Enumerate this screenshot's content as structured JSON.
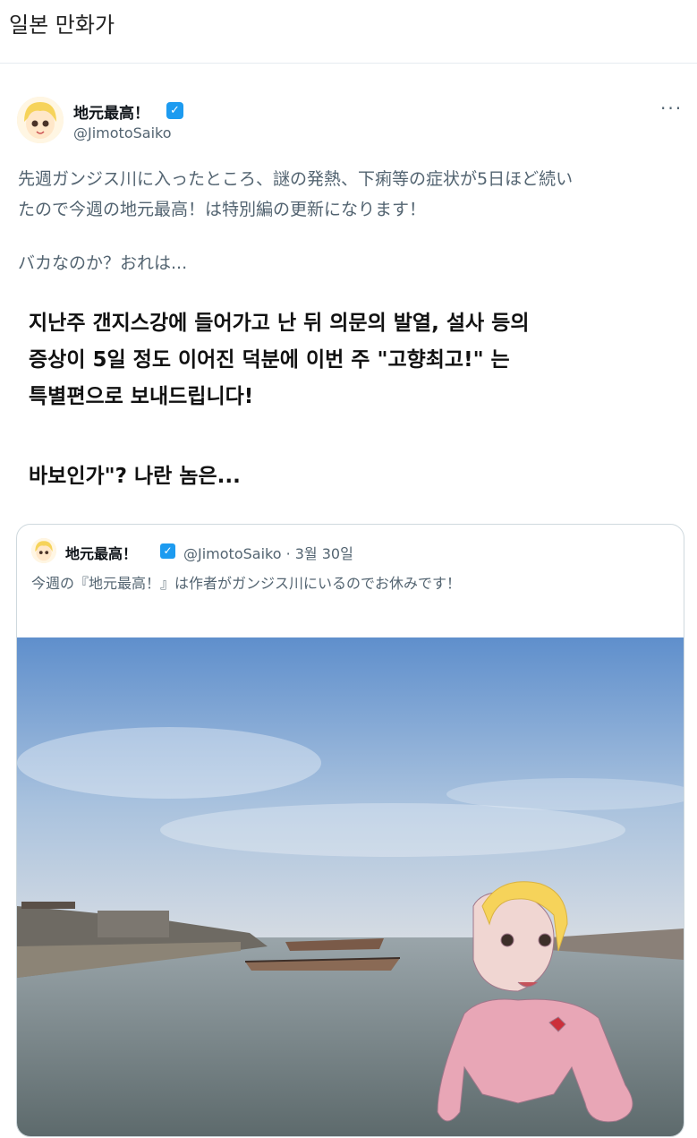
{
  "post": {
    "title": "일본 만화가"
  },
  "tweet": {
    "author_name": "地元最高！",
    "handle": "@JimotoSaiko",
    "verified_icon": "✓",
    "more_icon": "···",
    "text_jp_line1": "先週ガンジス川に入ったところ、謎の発熱、下痢等の症状が5日ほど続い",
    "text_jp_line2": "たので今週の地元最高！は特別編の更新になります！",
    "text_jp_question": "バカなのか？おれは...",
    "text_kr_line1": "지난주 갠지스강에 들어가고 난 뒤 의문의 발열, 설사 등의",
    "text_kr_line2": "증상이 5일 정도 이어진 덕분에 이번 주 \"고향최고!\" 는",
    "text_kr_line3": "특별편으로 보내드립니다!",
    "text_kr_question": "바보인가\"? 나란 놈은..."
  },
  "quoted_tweet": {
    "author_name": "地元最高！",
    "handle_and_date": "@JimotoSaiko · 3월 30일",
    "text": "今週の『地元最高！』は作者がガンジス川にいるのでお休みです！",
    "image_icon": "river-photo"
  },
  "colors": {
    "accent": "#1d9bf0",
    "secondary_text": "#536471",
    "border": "#cfd9de"
  }
}
